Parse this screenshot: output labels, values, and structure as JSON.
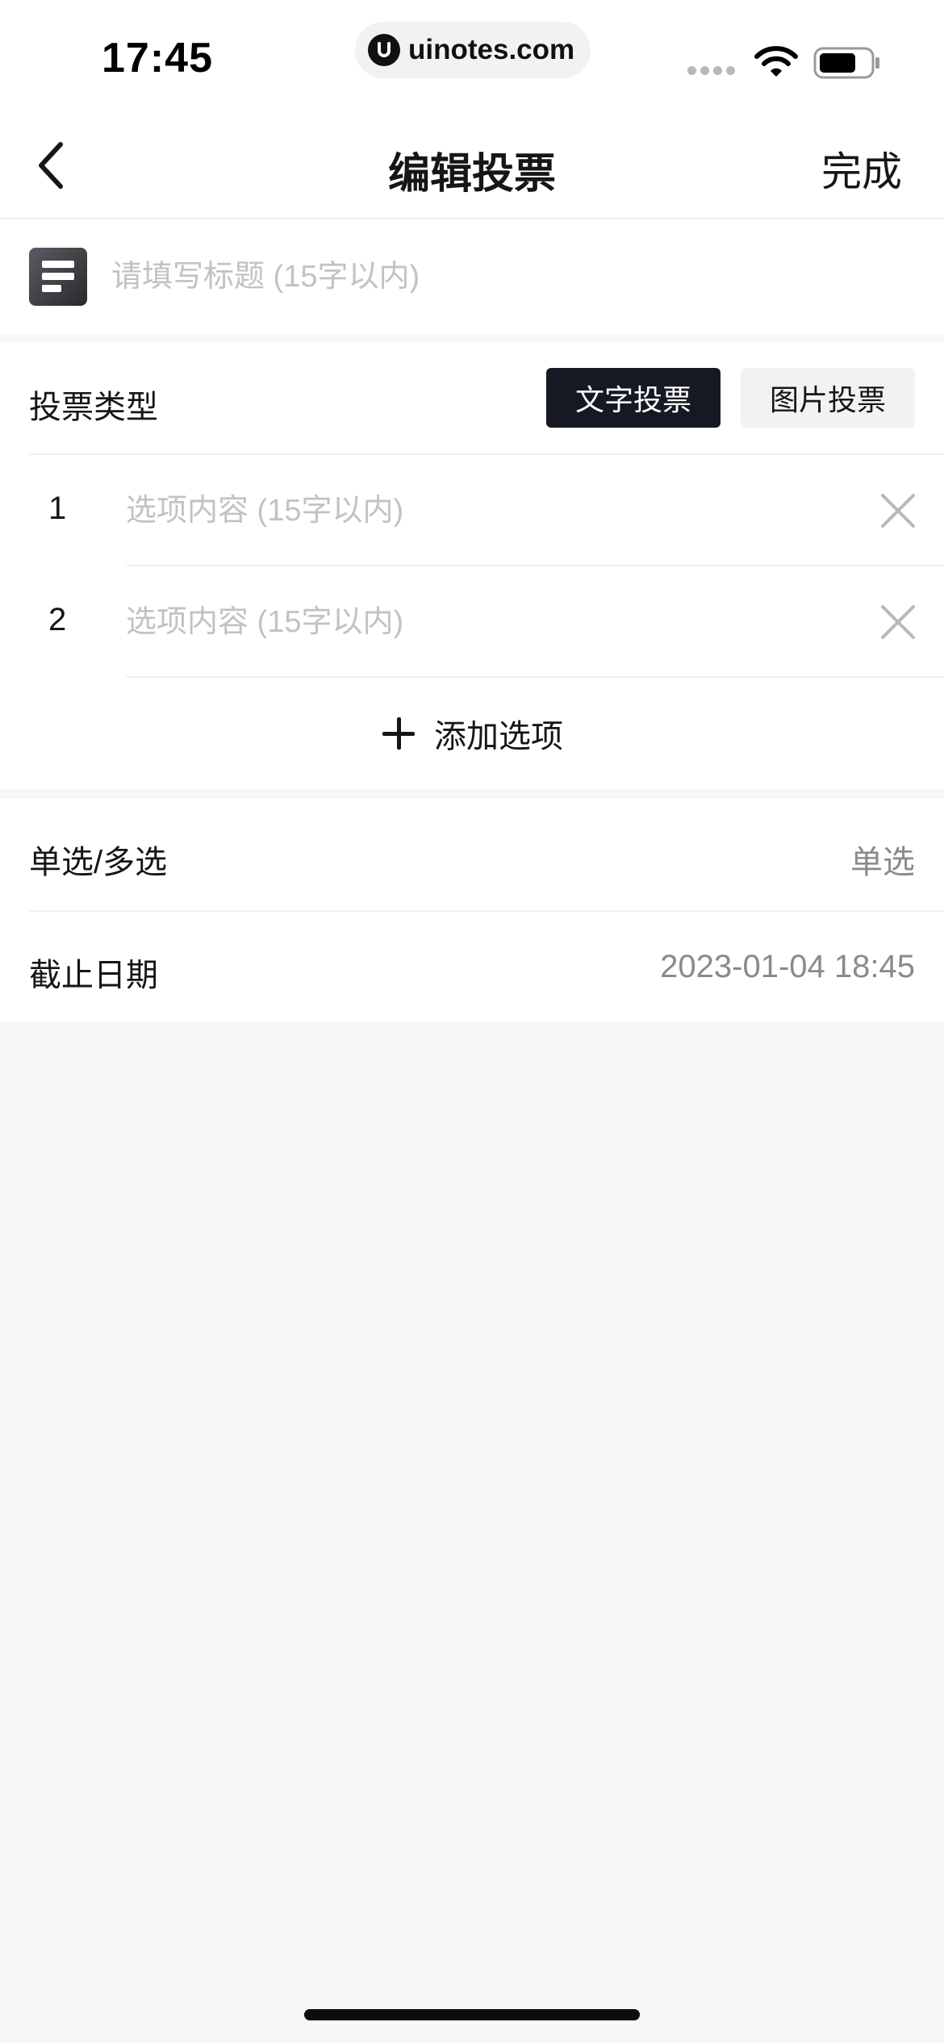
{
  "status_bar": {
    "time": "17:45",
    "url": "uinotes.com",
    "icons": [
      "signal-icon",
      "wifi-icon",
      "battery-icon"
    ]
  },
  "nav": {
    "back_icon": "chevron-left-icon",
    "title": "编辑投票",
    "done_label": "完成"
  },
  "title_field": {
    "icon": "text-lines-icon",
    "placeholder": "请填写标题 (15字以内)",
    "value": ""
  },
  "vote_type": {
    "label": "投票类型",
    "options": [
      "文字投票",
      "图片投票"
    ],
    "selected": "文字投票"
  },
  "options": [
    {
      "number": "1",
      "placeholder": "选项内容 (15字以内)",
      "value": ""
    },
    {
      "number": "2",
      "placeholder": "选项内容 (15字以内)",
      "value": ""
    }
  ],
  "add_option": {
    "icon": "plus-icon",
    "label": "添加选项"
  },
  "settings": {
    "selection_mode": {
      "label": "单选/多选",
      "value": "单选"
    },
    "deadline": {
      "label": "截止日期",
      "value": "2023-01-04 18:45"
    }
  },
  "colors": {
    "accent_dark": "#161823",
    "placeholder": "#c2c2c6",
    "secondary_text": "#8a8a8e",
    "background": "#f7f7f7"
  }
}
